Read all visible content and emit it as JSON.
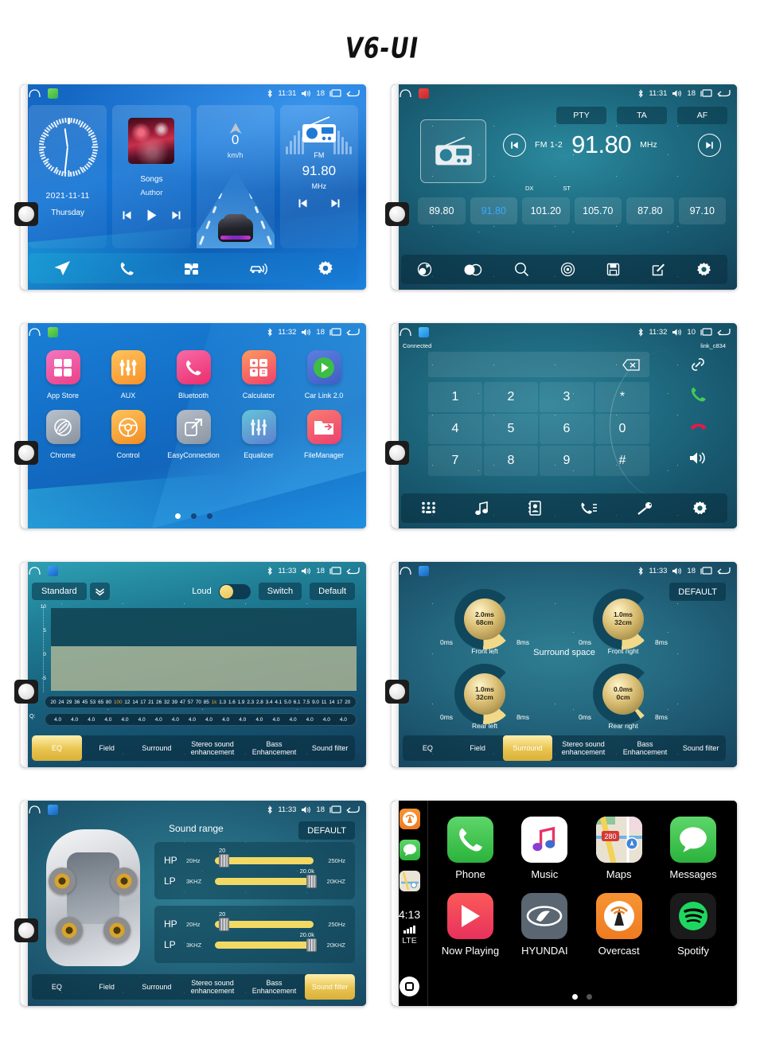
{
  "page": {
    "title": "V6-UI"
  },
  "screens": [
    {
      "id": "home",
      "status": {
        "time": "11:31",
        "volume": "18"
      },
      "widgets": {
        "clock": {
          "date": "2021-11-11",
          "weekday": "Thursday"
        },
        "music": {
          "title": "Songs",
          "artist": "Author"
        },
        "speed": {
          "value": "0",
          "unit": "km/h"
        },
        "radio": {
          "band": "FM",
          "freq": "91.80",
          "unit": "MHz"
        }
      },
      "dock": [
        "navigation-icon",
        "phone-icon",
        "apps-icon",
        "carlink-icon",
        "settings-icon"
      ]
    },
    {
      "id": "radio",
      "status": {
        "time": "11:31",
        "volume": "18"
      },
      "rds": [
        "PTY",
        "TA",
        "AF"
      ],
      "band_label": "FM 1-2",
      "freq": "91.80",
      "unit": "MHz",
      "modes": [
        "DX",
        "ST"
      ],
      "presets": [
        "89.80",
        "91.80",
        "101.20",
        "105.70",
        "87.80",
        "97.10"
      ],
      "active_preset": "91.80",
      "toolbar": [
        "band-icon",
        "stereo-icon",
        "search-icon",
        "local-icon",
        "save-icon",
        "edit-icon",
        "settings-icon"
      ]
    },
    {
      "id": "apps",
      "status": {
        "time": "11:32",
        "volume": "18"
      },
      "rows": [
        [
          {
            "label": "App Store",
            "icon": "appstore-icon"
          },
          {
            "label": "AUX",
            "icon": "aux-icon"
          },
          {
            "label": "Bluetooth",
            "icon": "bluetooth-icon"
          },
          {
            "label": "Calculator",
            "icon": "calculator-icon"
          },
          {
            "label": "Car Link 2.0",
            "icon": "carlink-icon"
          }
        ],
        [
          {
            "label": "Chrome",
            "icon": "chrome-icon"
          },
          {
            "label": "Control",
            "icon": "steering-wheel-icon"
          },
          {
            "label": "EasyConnection",
            "icon": "easyconnection-icon"
          },
          {
            "label": "Equalizer",
            "icon": "equalizer-icon"
          },
          {
            "label": "FileManager",
            "icon": "folder-icon"
          }
        ]
      ],
      "page_dots": 3,
      "active_dot": 0
    },
    {
      "id": "phone",
      "status": {
        "time": "11:32",
        "volume": "10"
      },
      "connection_status": "Connected",
      "device_name": "link_c834",
      "dial_value": "",
      "keys": [
        [
          "1",
          "2",
          "3",
          "*"
        ],
        [
          "4",
          "5",
          "6",
          "0"
        ],
        [
          "7",
          "8",
          "9",
          "#"
        ]
      ],
      "side_actions": [
        "link-icon",
        "call-icon",
        "hangup-icon",
        "speaker-icon"
      ],
      "toolbar": [
        "keypad-icon",
        "music-icon",
        "contacts-icon",
        "call-log-icon",
        "disconnect-icon",
        "settings-icon"
      ]
    },
    {
      "id": "equalizer",
      "status": {
        "time": "11:33",
        "volume": "18"
      },
      "preset_name": "Standard",
      "loud_label": "Loud",
      "loud_on": true,
      "switch_label": "Switch",
      "default_label": "Default",
      "y_axis": [
        "10",
        "5",
        "0",
        "-5"
      ],
      "frequencies": [
        "20",
        "24",
        "29",
        "36",
        "45",
        "53",
        "65",
        "80",
        "100",
        "12",
        "14",
        "17",
        "21",
        "26",
        "32",
        "39",
        "47",
        "57",
        "70",
        "85",
        "1k",
        "1.3",
        "1.6",
        "1.9",
        "2.3",
        "2.8",
        "3.4",
        "4.1",
        "5.0",
        "6.1",
        "7.5",
        "9.0",
        "11",
        "14",
        "17",
        "20"
      ],
      "highlight_freqs": [
        "100",
        "1k"
      ],
      "q_label": "Q:",
      "q_values": [
        "4.0",
        "4.0",
        "4.0",
        "4.0",
        "4.0",
        "4.0",
        "4.0",
        "4.0",
        "4.0",
        "4.0",
        "4.0",
        "4.0",
        "4.0",
        "4.0",
        "4.0",
        "4.0",
        "4.0",
        "4.0"
      ],
      "tabs": [
        "EQ",
        "Field",
        "Surround",
        "Stereo sound enhancement",
        "Bass Enhancement",
        "Sound filter"
      ],
      "active_tab": "EQ"
    },
    {
      "id": "surround",
      "status": {
        "time": "11:33",
        "volume": "18"
      },
      "default_label": "DEFAULT",
      "title": "Surround space",
      "knobs": [
        {
          "label": "Front left",
          "value_ms": "2.0ms",
          "value_cm": "68cm",
          "min": "0ms",
          "max": "8ms"
        },
        {
          "label": "Front right",
          "value_ms": "1.0ms",
          "value_cm": "32cm",
          "min": "0ms",
          "max": "8ms"
        },
        {
          "label": "Rear left",
          "value_ms": "1.0ms",
          "value_cm": "32cm",
          "min": "0ms",
          "max": "8ms"
        },
        {
          "label": "Rear right",
          "value_ms": "0.0ms",
          "value_cm": "0cm",
          "min": "0ms",
          "max": "8ms"
        }
      ],
      "tabs": [
        "EQ",
        "Field",
        "Surround",
        "Stereo sound enhancement",
        "Bass Enhancement",
        "Sound filter"
      ],
      "active_tab": "Surround"
    },
    {
      "id": "soundfilter",
      "status": {
        "time": "11:33",
        "volume": "18"
      },
      "title": "Sound range",
      "default_label": "DEFAULT",
      "panels": [
        {
          "rows": [
            {
              "tag": "HP",
              "min": "20Hz",
              "max": "250Hz",
              "value": "20",
              "pct": 4
            },
            {
              "tag": "LP",
              "min": "3KHZ",
              "max": "20KHZ",
              "value": "20.0k",
              "pct": 93
            }
          ]
        },
        {
          "rows": [
            {
              "tag": "HP",
              "min": "20Hz",
              "max": "250Hz",
              "value": "20",
              "pct": 4
            },
            {
              "tag": "LP",
              "min": "3KHZ",
              "max": "20KHZ",
              "value": "20.0k",
              "pct": 93
            }
          ]
        }
      ],
      "tabs": [
        "EQ",
        "Field",
        "Surround",
        "Stereo sound enhancement",
        "Bass Enhancement",
        "Sound filter"
      ],
      "active_tab": "Sound filter"
    },
    {
      "id": "carplay",
      "sidebar": {
        "time": "4:13",
        "network": "LTE",
        "icons": [
          "overcast-icon",
          "messages-icon",
          "maps-icon"
        ]
      },
      "rows": [
        [
          {
            "label": "Phone",
            "icon": "phone-icon"
          },
          {
            "label": "Music",
            "icon": "music-icon"
          },
          {
            "label": "Maps",
            "icon": "maps-icon"
          },
          {
            "label": "Messages",
            "icon": "messages-icon"
          }
        ],
        [
          {
            "label": "Now Playing",
            "icon": "now-playing-icon"
          },
          {
            "label": "HYUNDAI",
            "icon": "hyundai-icon"
          },
          {
            "label": "Overcast",
            "icon": "overcast-icon"
          },
          {
            "label": "Spotify",
            "icon": "spotify-icon"
          }
        ]
      ],
      "page_dots": 2,
      "active_dot": 0
    }
  ],
  "colors": {
    "accent_gold": "#e8c44e",
    "accent_blue": "#3aa8ff",
    "home_blue": "#1565c0",
    "teal": "#1f7e95"
  }
}
